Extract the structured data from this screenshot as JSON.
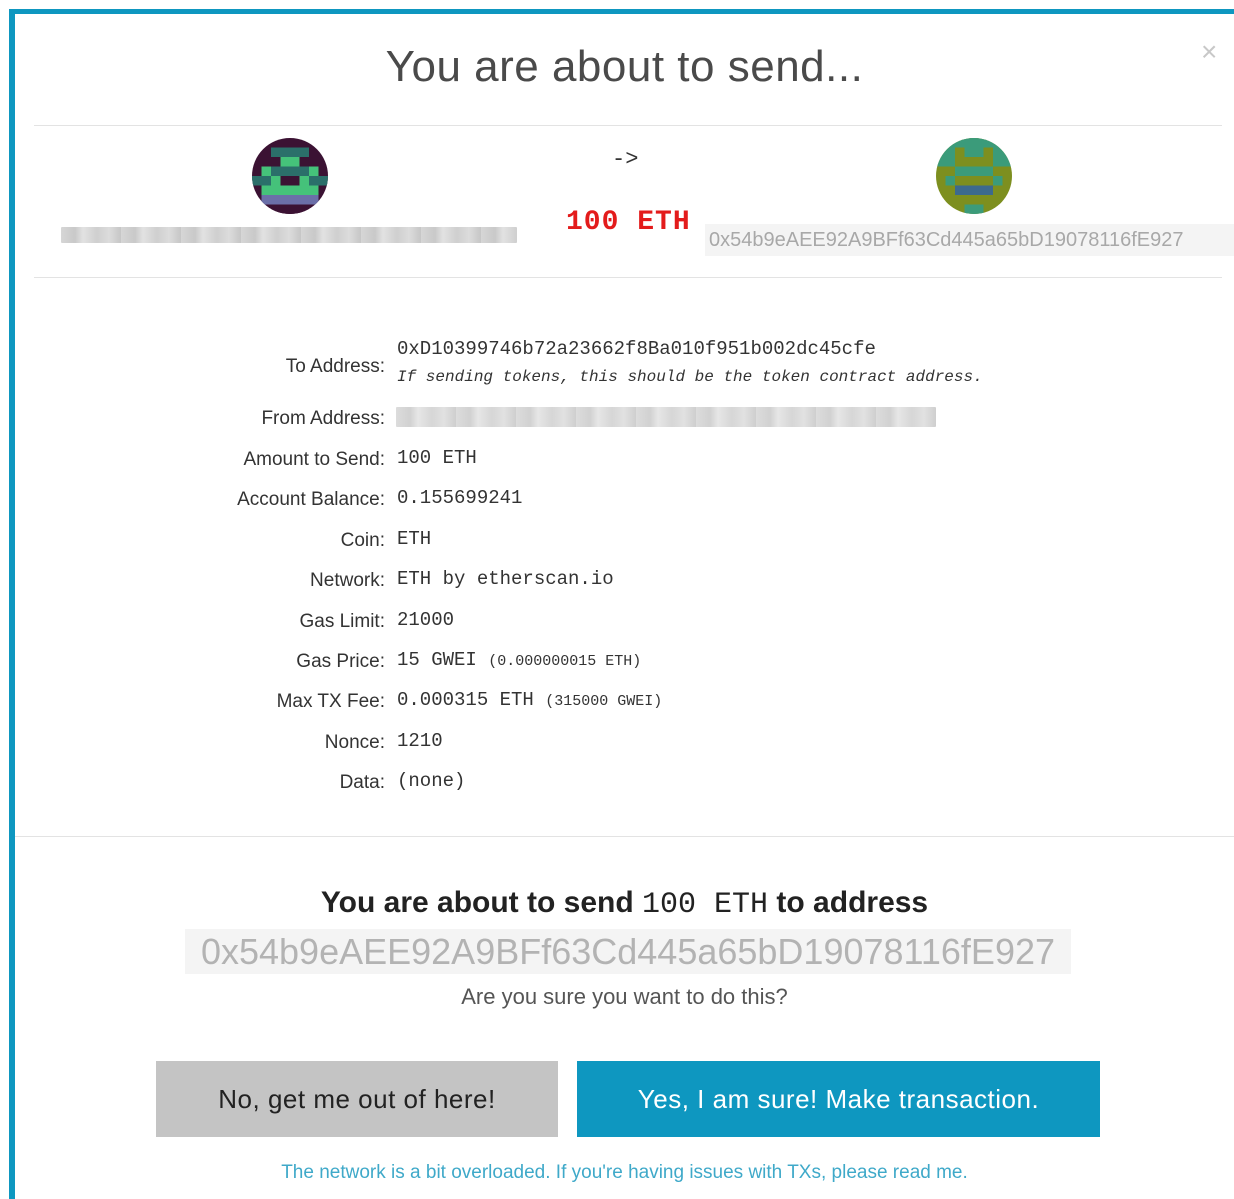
{
  "modal": {
    "title": "You are about to send...",
    "close_glyph": "×"
  },
  "summary": {
    "arrow": "->",
    "amount": "100 ETH",
    "to_address": "0x54b9eAEE92A9BFf63Cd445a65bD19078116fE927"
  },
  "details": {
    "to_label": "To Address:",
    "to_value": "0xD10399746b72a23662f8Ba010f951b002dc45cfe",
    "to_note": "If sending tokens, this should be the token contract address.",
    "from_label": "From Address:",
    "amount_label": "Amount to Send:",
    "amount_value": "100 ETH",
    "balance_label": "Account Balance:",
    "balance_value": "0.155699241",
    "coin_label": "Coin:",
    "coin_value": "ETH",
    "network_label": "Network:",
    "network_value": "ETH by etherscan.io",
    "gas_limit_label": "Gas Limit:",
    "gas_limit_value": "21000",
    "gas_price_label": "Gas Price:",
    "gas_price_value": "15 GWEI",
    "gas_price_eth": "(0.000000015 ETH)",
    "max_fee_label": "Max TX Fee:",
    "max_fee_value": "0.000315 ETH",
    "max_fee_gwei": "(315000 GWEI)",
    "nonce_label": "Nonce:",
    "nonce_value": "1210",
    "data_label": "Data:",
    "data_value": "(none)"
  },
  "confirm": {
    "prefix": "You are about to send",
    "amount": "100 ETH",
    "suffix": "to address",
    "address": "0x54b9eAEE92A9BFf63Cd445a65bD19078116fE927",
    "question": "Are you sure you want to do this?"
  },
  "buttons": {
    "no_label": "No, get me out of here!",
    "yes_label": "Yes, I am sure! Make transaction."
  },
  "footer": {
    "link_text": "The network is a bit overloaded. If you're having issues with TXs, please read me."
  },
  "colors": {
    "accent": "#0e97c0",
    "amount_red": "#e31b1b",
    "link": "#3fa9c9"
  },
  "icons": [
    "close-icon",
    "from-identicon",
    "to-identicon"
  ]
}
